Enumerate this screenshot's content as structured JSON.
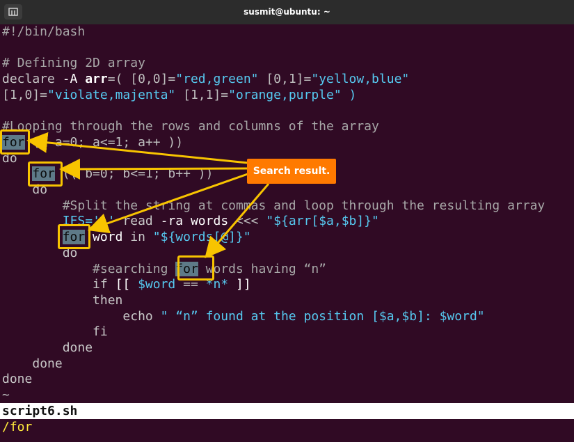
{
  "window": {
    "title": "susmit@ubuntu: ~"
  },
  "code": {
    "l1": "#!/bin/bash",
    "l3": "# Defining 2D array",
    "l4a": "declare ",
    "l4b": "-A ",
    "l4c": "arr",
    "l4d": "=( [0,0]=",
    "l4e": "\"red,green\"",
    "l4f": " [0,1]=",
    "l4g": "\"yellow,blue\"",
    "l5a": "[1,0]=",
    "l5b": "\"violate,majenta\"",
    "l5c": " [1,1]=",
    "l5d": "\"orange,purple\"",
    "l5e": " )",
    "l7": "#Looping through the rows and columns of the array",
    "l8a": "for",
    "l8b": " (( a=0; a<=1; a++ ))",
    "l9": "do",
    "l10a": "for",
    "l10b": " (( b=0; b<=1; b++ ))",
    "l11": "do",
    "l12": "#Split the string at commas and loop through the resulting array",
    "l13a": "IFS=",
    "l13b": "','",
    "l13c": " read ",
    "l13d": "-ra ",
    "l13e": "words",
    "l13f": " <<< ",
    "l13g": "\"${arr[$a,$b]}\"",
    "l14a": "for",
    "l14b": " word ",
    "l14c": "in ",
    "l14d": "\"${words[@]}\"",
    "l15": "do",
    "l16a": "#searching ",
    "l16b": "for",
    "l16c": " words having “n”",
    "l17a": "if ",
    "l17b": "[[ ",
    "l17c": "$word",
    "l17d": " == ",
    "l17e": "*n*",
    "l17f": " ]]",
    "l18": "then",
    "l19a": "echo ",
    "l19b": "\" “n” found at the position [",
    "l19c": "$a",
    "l19d": ",",
    "l19e": "$b",
    "l19f": "]: ",
    "l19g": "$word",
    "l19h": "\"",
    "l20": "fi",
    "l21": "done",
    "l22": "done",
    "l23": "done",
    "l24": "~"
  },
  "status": {
    "filename": "script6.sh",
    "command": "/for"
  },
  "annotation": {
    "label": "Search result."
  },
  "colors": {
    "background": "#300a24",
    "highlight": "#5e7a88",
    "box": "#f8c400",
    "callout": "#ff7a00",
    "command": "#ffea3b"
  }
}
